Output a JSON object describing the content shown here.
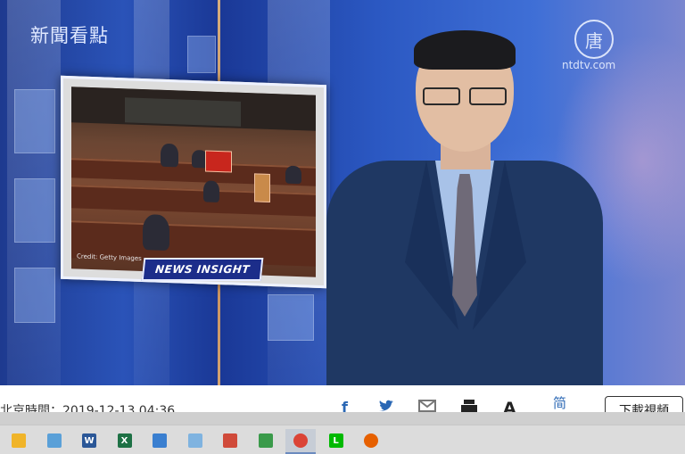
{
  "video": {
    "channel_title": "新聞看點",
    "logo_glyph": "唐",
    "logo_url": "ntdtv.com",
    "inset": {
      "credit": "Credit: Getty Images",
      "badge": "NEWS INSIGHT"
    }
  },
  "info_bar": {
    "timestamp": "北京時間：2019-12-13 04:36",
    "share_icons": [
      "facebook-icon",
      "twitter-icon",
      "email-icon",
      "print-icon",
      "font-size-icon",
      "simplified-chinese-icon"
    ],
    "font_size_label": "A",
    "simplified_label": "简",
    "download_label": "下載視頻"
  },
  "taskbar": {
    "apps": [
      {
        "name": "file-explorer-icon",
        "color": "#f0b429"
      },
      {
        "name": "notepad-icon",
        "color": "#5aa0d8"
      },
      {
        "name": "word-icon",
        "color": "#2b5797",
        "letter": "W"
      },
      {
        "name": "excel-icon",
        "color": "#1e7145",
        "letter": "X"
      },
      {
        "name": "cloud-drive-icon",
        "color": "#3a7fd0"
      },
      {
        "name": "paint-icon",
        "color": "#7fb3e0"
      },
      {
        "name": "photo-viewer-icon",
        "color": "#d04a3a"
      },
      {
        "name": "image-app-icon",
        "color": "#3a9a4a"
      },
      {
        "name": "chrome-icon",
        "color": "#db4437"
      },
      {
        "name": "line-icon",
        "color": "#00b900",
        "letter": "L"
      },
      {
        "name": "firefox-icon",
        "color": "#e66000"
      }
    ],
    "active_index": 8
  }
}
